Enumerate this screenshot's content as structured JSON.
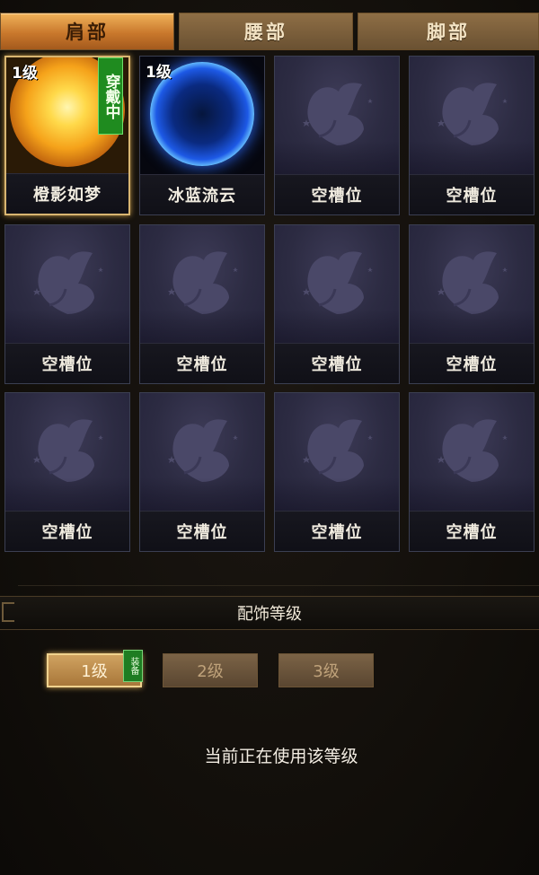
{
  "tabs": [
    {
      "label": "肩部",
      "active": true
    },
    {
      "label": "腰部",
      "active": false
    },
    {
      "label": "脚部",
      "active": false
    }
  ],
  "slots": [
    {
      "name": "橙影如梦",
      "level": "1级",
      "badge": "穿戴中",
      "art": "sun",
      "selected": true
    },
    {
      "name": "冰蓝流云",
      "level": "1级",
      "badge": "",
      "art": "orb",
      "selected": false
    },
    {
      "name": "空槽位",
      "level": "",
      "badge": "",
      "art": "butterfly-placeholder",
      "selected": false
    },
    {
      "name": "空槽位",
      "level": "",
      "badge": "",
      "art": "butterfly-placeholder",
      "selected": false
    },
    {
      "name": "空槽位",
      "level": "",
      "badge": "",
      "art": "butterfly-placeholder",
      "selected": false
    },
    {
      "name": "空槽位",
      "level": "",
      "badge": "",
      "art": "butterfly-placeholder",
      "selected": false
    },
    {
      "name": "空槽位",
      "level": "",
      "badge": "",
      "art": "butterfly-placeholder",
      "selected": false
    },
    {
      "name": "空槽位",
      "level": "",
      "badge": "",
      "art": "butterfly-placeholder",
      "selected": false
    },
    {
      "name": "空槽位",
      "level": "",
      "badge": "",
      "art": "butterfly-placeholder",
      "selected": false
    },
    {
      "name": "空槽位",
      "level": "",
      "badge": "",
      "art": "butterfly-placeholder",
      "selected": false
    },
    {
      "name": "空槽位",
      "level": "",
      "badge": "",
      "art": "butterfly-placeholder",
      "selected": false
    },
    {
      "name": "空槽位",
      "level": "",
      "badge": "",
      "art": "butterfly-placeholder",
      "selected": false
    }
  ],
  "section": {
    "title": "配饰等级"
  },
  "levels": [
    {
      "label": "1级",
      "active": true,
      "tag": "装备"
    },
    {
      "label": "2级",
      "active": false,
      "tag": ""
    },
    {
      "label": "3级",
      "active": false,
      "tag": ""
    }
  ],
  "status_text": "当前正在使用该等级",
  "colors": {
    "accent": "#d8b571",
    "wearing_badge": "#1f8b1f",
    "tab_active": "#e39a45"
  }
}
